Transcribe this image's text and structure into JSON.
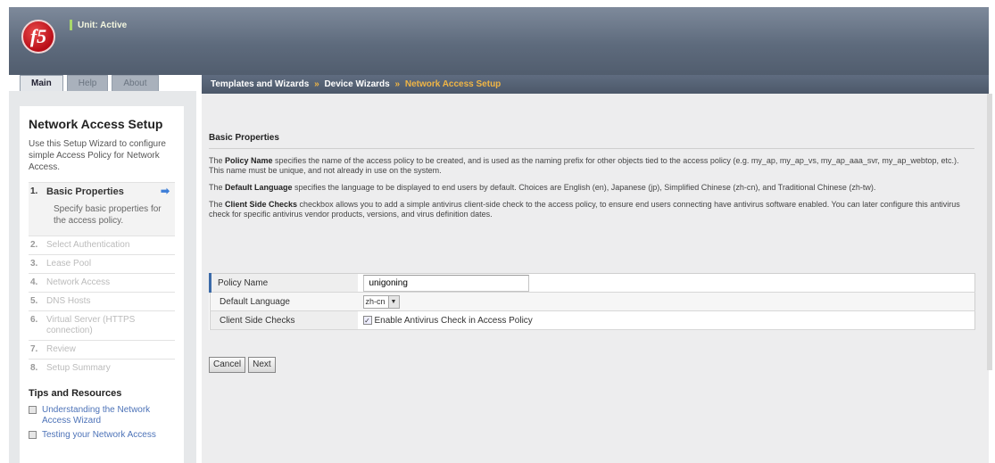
{
  "header": {
    "logo_text": "f5",
    "unit_status": "Unit: Active"
  },
  "tabs": [
    {
      "label": "Main",
      "active": true
    },
    {
      "label": "Help",
      "active": false
    },
    {
      "label": "About",
      "active": false
    }
  ],
  "breadcrumb": {
    "items": [
      "Templates and Wizards",
      "Device Wizards"
    ],
    "separator": "»",
    "current": "Network Access Setup"
  },
  "sidebar": {
    "title": "Network Access Setup",
    "intro": "Use this Setup Wizard to configure simple Access Policy for Network Access.",
    "steps": [
      {
        "num": "1.",
        "label": "Basic Properties",
        "desc": "Specify basic properties for the access policy."
      },
      {
        "num": "2.",
        "label": "Select Authentication"
      },
      {
        "num": "3.",
        "label": "Lease Pool"
      },
      {
        "num": "4.",
        "label": "Network Access"
      },
      {
        "num": "5.",
        "label": "DNS Hosts"
      },
      {
        "num": "6.",
        "label": "Virtual Server (HTTPS connection)"
      },
      {
        "num": "7.",
        "label": "Review"
      },
      {
        "num": "8.",
        "label": "Setup Summary"
      }
    ],
    "tips_title": "Tips and Resources",
    "tips": [
      "Understanding the Network Access Wizard",
      "Testing your Network Access"
    ]
  },
  "main": {
    "section_title": "Basic Properties",
    "para1": {
      "bold": "Policy Name",
      "text": " specifies the name of the access policy to be created, and is used as the naming prefix for other objects tied to the access policy (e.g. my_ap, my_ap_vs, my_ap_aaa_svr, my_ap_webtop, etc.). This name must be unique, and not already in use on the system."
    },
    "para2": {
      "pre": "The ",
      "bold": "Default Language",
      "text": " specifies the language to be displayed to end users by default. Choices are English (en), Japanese (jp), Simplified Chinese (zh-cn), and Traditional Chinese (zh-tw)."
    },
    "para3": {
      "pre": "The ",
      "bold": "Client Side Checks",
      "text": " checkbox allows you to add a simple antivirus client-side check to the access policy, to ensure end users connecting have antivirus software enabled. You can later configure this antivirus check for specific antivirus vendor products, versions, and virus definition dates."
    },
    "form": {
      "policy_name_label": "Policy Name",
      "policy_name_value": "unigoning",
      "default_language_label": "Default Language",
      "default_language_value": "zh-cn",
      "client_side_checks_label": "Client Side Checks",
      "client_side_checks_text": "Enable Antivirus Check in Access Policy",
      "client_side_checks_checked": true
    },
    "buttons": {
      "cancel": "Cancel",
      "next": "Next"
    }
  }
}
